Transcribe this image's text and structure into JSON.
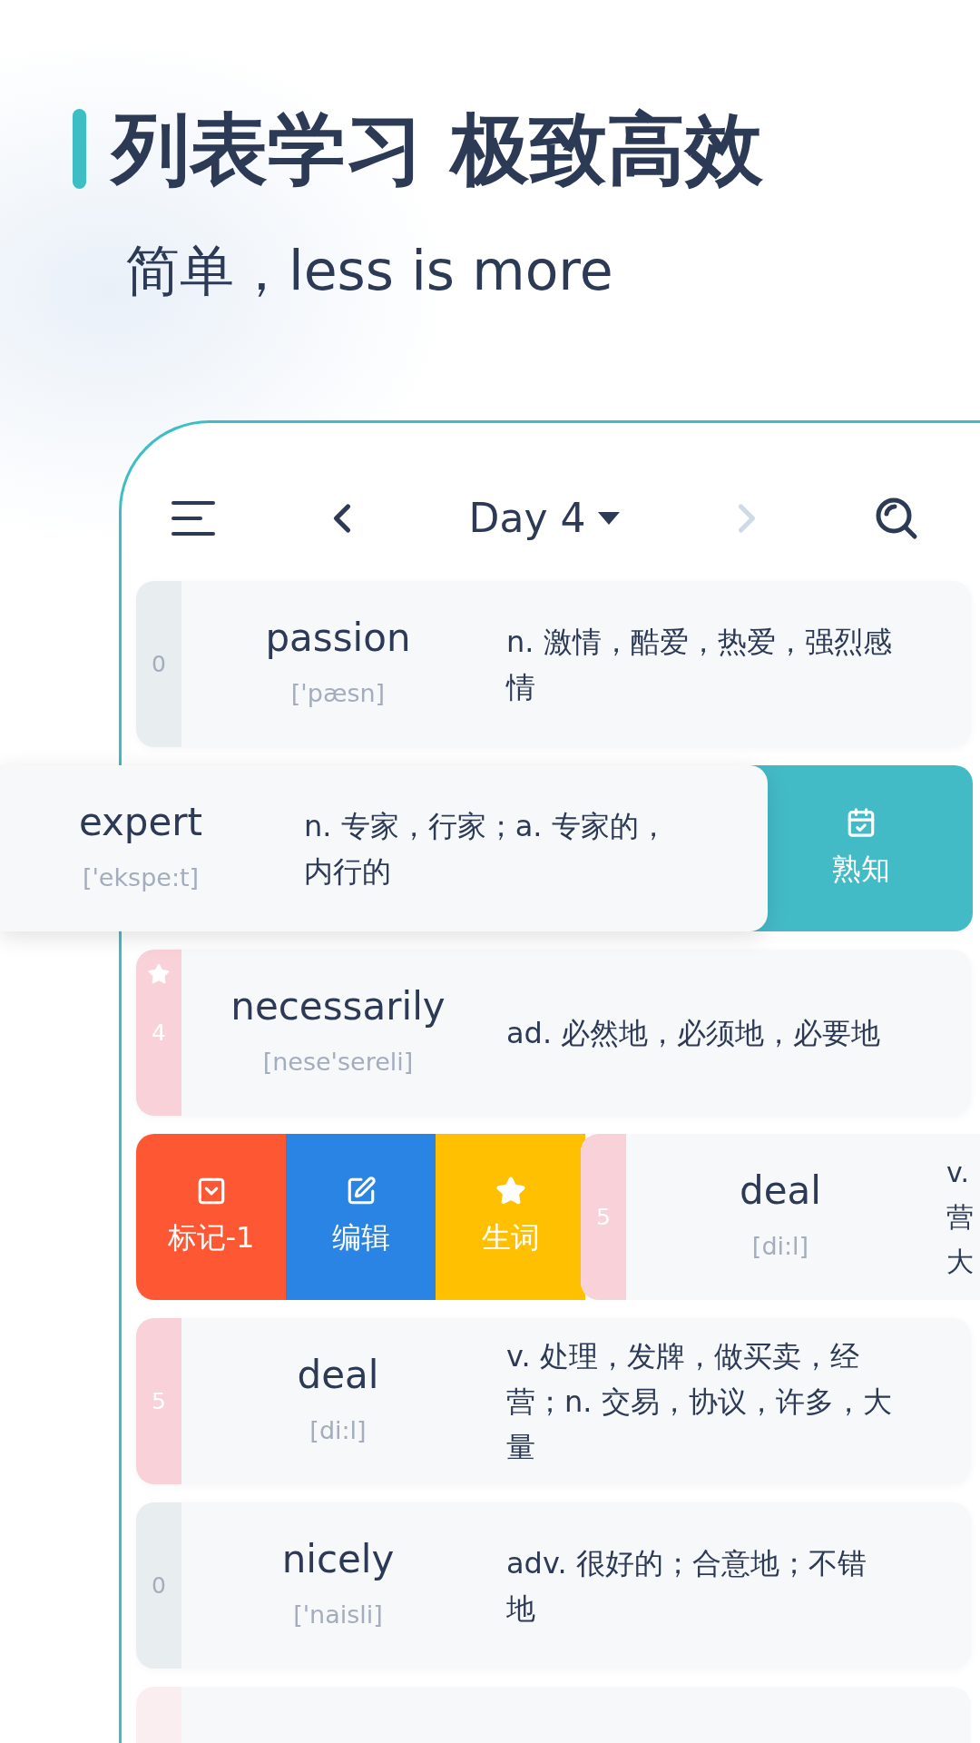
{
  "headline": {
    "title": "列表学习 极致高效",
    "subtitle": "简单，less is more"
  },
  "toolbar": {
    "title": "Day 4",
    "back_disabled": false,
    "forward_disabled": true
  },
  "rows": [
    {
      "kind": "normal",
      "count": "0",
      "color": "#e8edf0",
      "muted": true,
      "starred": false,
      "word": "passion",
      "phonetic": "['pæsn]",
      "definition": "n. 激情，酷爱，热爱，强烈感情"
    },
    {
      "kind": "revealed_right",
      "word": "expert",
      "phonetic": "['ekspe:t]",
      "definition": "n. 专家，行家；a. 专家的，内行的",
      "actions": [
        {
          "kind": "known",
          "label": "熟知",
          "color": "#43bbc7"
        }
      ]
    },
    {
      "kind": "normal",
      "count": "4",
      "color": "#f8d2d8",
      "muted": false,
      "starred": true,
      "word": "necessarily",
      "phonetic": "[nese'sereli]",
      "definition": "ad. 必然地，必须地，必要地"
    },
    {
      "kind": "revealed_left",
      "count": "5",
      "color": "#f8d2d8",
      "muted": false,
      "starred": false,
      "word": "deal",
      "phonetic": "[di:l]",
      "definition_lines": [
        "v.",
        "营",
        "大"
      ],
      "actions": [
        {
          "kind": "mark",
          "label": "标记-1",
          "color": "#fe5733"
        },
        {
          "kind": "edit",
          "label": "编辑",
          "color": "#2a84e3"
        },
        {
          "kind": "star",
          "label": "生词",
          "color": "#fec000"
        }
      ]
    },
    {
      "kind": "normal",
      "count": "5",
      "color": "#f8d2d8",
      "muted": false,
      "starred": false,
      "word": "deal",
      "phonetic": "[di:l]",
      "definition": "v. 处理，发牌，做买卖，经营；n. 交易，协议，许多，大量"
    },
    {
      "kind": "normal",
      "count": "0",
      "color": "#e8edf0",
      "muted": true,
      "starred": false,
      "word": "nicely",
      "phonetic": "['naisli]",
      "definition": "adv. 很好的；合意地；不错地"
    },
    {
      "kind": "partial",
      "color": "#fbeef0"
    }
  ]
}
